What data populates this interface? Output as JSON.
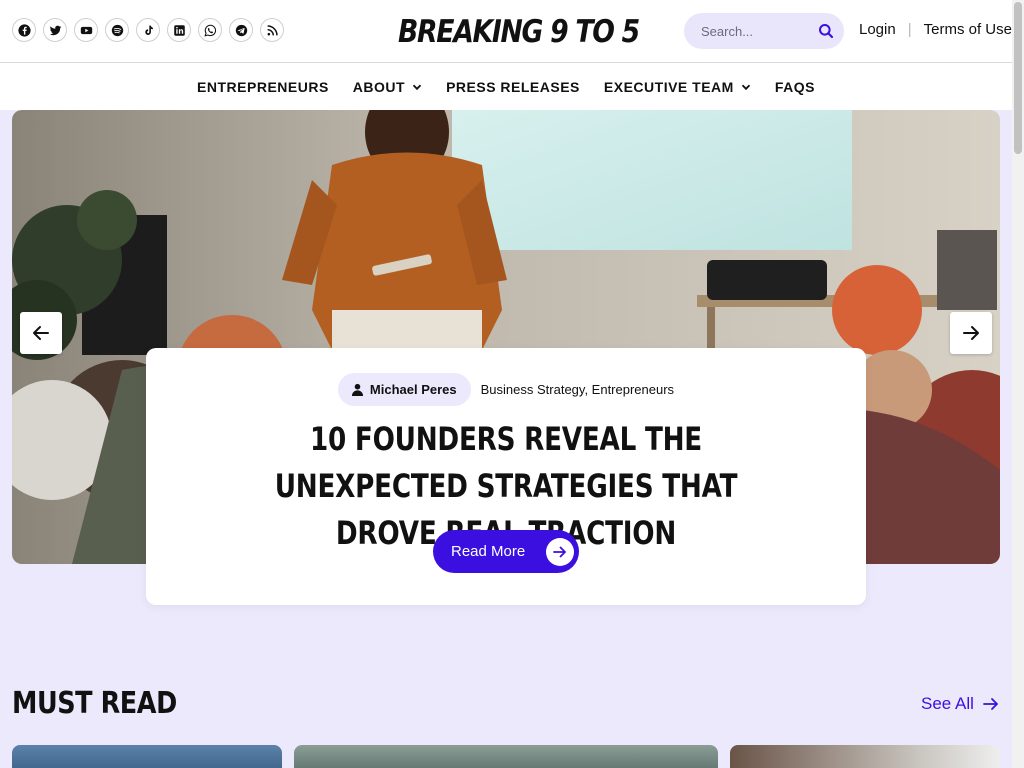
{
  "header": {
    "logo": "BREAKING 9 TO 5",
    "search": {
      "placeholder": "Search..."
    },
    "login_label": "Login",
    "separator": "|",
    "terms_label": "Terms of Use",
    "socials": [
      "facebook-icon",
      "twitter-icon",
      "youtube-icon",
      "spotify-icon",
      "tiktok-icon",
      "linkedin-icon",
      "whatsapp-icon",
      "telegram-icon",
      "rss-icon"
    ]
  },
  "nav": {
    "items": [
      {
        "label": "ENTREPRENEURS",
        "dropdown": false
      },
      {
        "label": "ABOUT",
        "dropdown": true
      },
      {
        "label": "PRESS RELEASES",
        "dropdown": false
      },
      {
        "label": "EXECUTIVE TEAM",
        "dropdown": true
      },
      {
        "label": "FAQS",
        "dropdown": false
      }
    ]
  },
  "hero": {
    "author": "Michael Peres",
    "categories": "Business Strategy, Entrepreneurs",
    "headline": "10 FOUNDERS REVEAL THE UNEXPECTED STRATEGIES THAT DROVE REAL TRACTION",
    "cta_label": "Read More"
  },
  "must_read": {
    "title": "MUST READ",
    "see_all_label": "See All"
  },
  "colors": {
    "accent": "#3b0fe0",
    "lavender": "#ebe9fb",
    "text": "#111111"
  }
}
